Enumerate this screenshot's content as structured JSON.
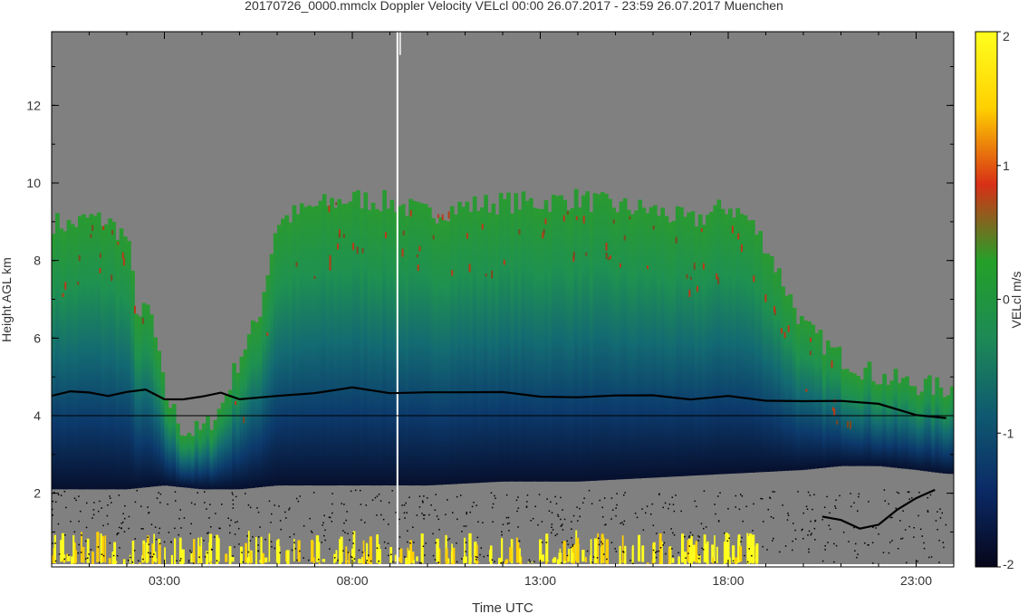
{
  "chart_data": {
    "type": "heatmap",
    "title": "20170726_0000.mmclx Doppler Velocity VELcl   00:00 26.07.2017 - 23:59 26.07.2017 Muenchen",
    "xlabel": "Time UTC",
    "ylabel": "Height AGL km",
    "x_ticks": [
      "03:00",
      "08:00",
      "13:00",
      "18:00",
      "23:00"
    ],
    "x_tick_hours": [
      3,
      8,
      13,
      18,
      23
    ],
    "xlim_hours": [
      0,
      24
    ],
    "y_ticks": [
      "2",
      "4",
      "6",
      "8",
      "10",
      "12"
    ],
    "y_tick_values": [
      2,
      4,
      6,
      8,
      10,
      12
    ],
    "ylim_km": [
      0.1,
      13.9
    ],
    "grid": false,
    "colorbar": {
      "label": "VELcl m/s",
      "ticks": [
        "2",
        "1",
        "0",
        "-1",
        "-2"
      ],
      "tick_values": [
        2,
        1,
        0,
        -1,
        -2
      ],
      "range": [
        -2,
        2
      ],
      "colors": [
        "#06061a",
        "#0b2a66",
        "#0f5a70",
        "#1d8a55",
        "#24a028",
        "#d83016",
        "#ffd000",
        "#ffff1e"
      ]
    },
    "background_color": "#808080",
    "reference_line_km": 4,
    "cloud_top_km": [
      [
        0.0,
        9.0
      ],
      [
        0.5,
        8.9
      ],
      [
        1.0,
        9.1
      ],
      [
        1.5,
        9.0
      ],
      [
        2.0,
        8.6
      ],
      [
        2.3,
        6.5
      ],
      [
        2.6,
        6.8
      ],
      [
        3.0,
        4.6
      ],
      [
        3.5,
        3.6
      ],
      [
        4.0,
        3.6
      ],
      [
        4.5,
        4.2
      ],
      [
        5.0,
        5.5
      ],
      [
        5.5,
        6.5
      ],
      [
        6.0,
        9.0
      ],
      [
        7.0,
        9.4
      ],
      [
        8.0,
        9.6
      ],
      [
        9.0,
        9.5
      ],
      [
        10.0,
        9.2
      ],
      [
        11.0,
        9.4
      ],
      [
        12.0,
        9.5
      ],
      [
        13.0,
        9.5
      ],
      [
        14.0,
        9.6
      ],
      [
        15.0,
        9.4
      ],
      [
        16.0,
        9.3
      ],
      [
        17.0,
        9.0
      ],
      [
        18.0,
        9.4
      ],
      [
        18.5,
        9.1
      ],
      [
        19.0,
        8.4
      ],
      [
        20.0,
        6.3
      ],
      [
        20.5,
        5.9
      ],
      [
        21.0,
        5.5
      ],
      [
        22.0,
        5.0
      ],
      [
        23.0,
        4.8
      ],
      [
        23.8,
        4.7
      ]
    ],
    "cloud_base_km": [
      [
        0.0,
        2.1
      ],
      [
        1.0,
        2.1
      ],
      [
        2.0,
        2.1
      ],
      [
        3.0,
        2.2
      ],
      [
        4.0,
        2.1
      ],
      [
        5.0,
        2.1
      ],
      [
        6.0,
        2.2
      ],
      [
        8.0,
        2.2
      ],
      [
        10.0,
        2.2
      ],
      [
        12.0,
        2.3
      ],
      [
        14.0,
        2.3
      ],
      [
        16.0,
        2.4
      ],
      [
        18.0,
        2.5
      ],
      [
        20.0,
        2.6
      ],
      [
        21.0,
        2.7
      ],
      [
        22.0,
        2.7
      ],
      [
        23.0,
        2.6
      ],
      [
        23.8,
        2.5
      ]
    ],
    "black_line_km": [
      [
        0.0,
        4.5
      ],
      [
        0.5,
        4.6
      ],
      [
        1.0,
        4.6
      ],
      [
        1.5,
        4.5
      ],
      [
        2.0,
        4.6
      ],
      [
        2.5,
        4.7
      ],
      [
        3.0,
        4.4
      ],
      [
        3.5,
        4.4
      ],
      [
        4.0,
        4.5
      ],
      [
        4.5,
        4.6
      ],
      [
        5.0,
        4.4
      ],
      [
        6.0,
        4.5
      ],
      [
        7.0,
        4.6
      ],
      [
        8.0,
        4.7
      ],
      [
        9.0,
        4.6
      ],
      [
        10.0,
        4.6
      ],
      [
        11.0,
        4.6
      ],
      [
        12.0,
        4.6
      ],
      [
        13.0,
        4.5
      ],
      [
        14.0,
        4.5
      ],
      [
        15.0,
        4.5
      ],
      [
        16.0,
        4.5
      ],
      [
        17.0,
        4.4
      ],
      [
        18.0,
        4.5
      ],
      [
        19.0,
        4.4
      ],
      [
        20.0,
        4.4
      ],
      [
        21.0,
        4.4
      ],
      [
        22.0,
        4.3
      ],
      [
        23.0,
        4.0
      ],
      [
        23.8,
        3.95
      ]
    ],
    "lower_black_line_km": [
      [
        20.5,
        1.4
      ],
      [
        21.0,
        1.3
      ],
      [
        21.5,
        1.1
      ],
      [
        22.0,
        1.2
      ],
      [
        22.5,
        1.6
      ],
      [
        23.0,
        1.9
      ],
      [
        23.5,
        2.1
      ]
    ],
    "white_artifact_hour": 9.2,
    "precip_top_km": 0.8
  }
}
